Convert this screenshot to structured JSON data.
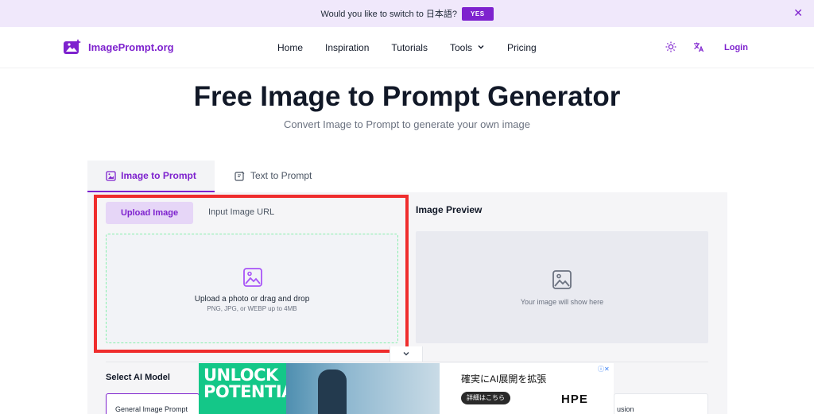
{
  "banner": {
    "text": "Would you like to switch to 日本語?",
    "yes_label": "YES",
    "close_icon": "close-icon"
  },
  "nav": {
    "logo_text": "ImagePrompt.org",
    "items": [
      "Home",
      "Inspiration",
      "Tutorials",
      "Tools",
      "Pricing"
    ],
    "login_label": "Login",
    "icons": [
      "sun-icon",
      "translate-icon",
      "chevron-down-icon"
    ]
  },
  "hero": {
    "title": "Free Image to Prompt Generator",
    "subtitle": "Convert Image to Prompt to generate your own image"
  },
  "tabs": [
    {
      "label": "Image to Prompt",
      "active": true
    },
    {
      "label": "Text to Prompt",
      "active": false
    }
  ],
  "upload": {
    "subtabs": [
      {
        "label": "Upload Image",
        "active": true
      },
      {
        "label": "Input Image URL",
        "active": false
      }
    ],
    "drop_text": "Upload a photo or drag and drop",
    "drop_hint": "PNG, JPG, or WEBP up to 4MB"
  },
  "preview": {
    "title": "Image Preview",
    "placeholder": "Your image will show here"
  },
  "model": {
    "label": "Select AI Model",
    "options": [
      "General Image Prompt",
      "usion"
    ]
  },
  "ad": {
    "headline_1": "UNLOCK",
    "headline_2": "POTENTIAL",
    "jp_text": "確実にAI展開を拡張",
    "cta": "詳細はこちら",
    "brand": "HPE"
  },
  "colors": {
    "accent": "#7e22ce",
    "highlight": "#ef2d2d",
    "banner_bg": "#f0e8fb"
  }
}
